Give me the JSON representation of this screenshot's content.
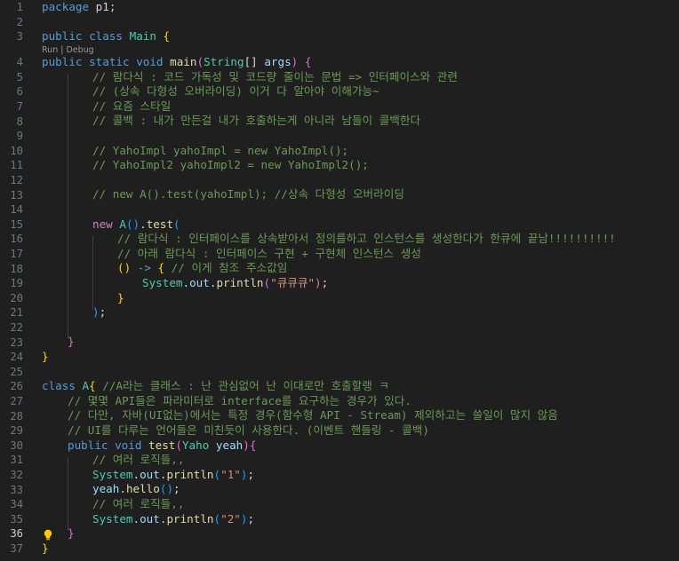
{
  "editor": {
    "line_numbers": [
      "1",
      "2",
      "3",
      "4",
      "5",
      "6",
      "7",
      "8",
      "9",
      "10",
      "11",
      "12",
      "13",
      "14",
      "15",
      "16",
      "17",
      "18",
      "19",
      "20",
      "21",
      "22",
      "23",
      "24",
      "25",
      "26",
      "27",
      "28",
      "29",
      "30",
      "31",
      "32",
      "33",
      "34",
      "35",
      "36",
      "37"
    ],
    "active_line": "36",
    "codelens": {
      "run": "Run",
      "separator": " | ",
      "debug": "Debug"
    },
    "code": {
      "l1_kw": "package",
      "l1_rest": " p1;",
      "l3_kw1": "public",
      "l3_kw2": "class",
      "l3_name": "Main",
      "l3_brace": "{",
      "l4_kw1": "public",
      "l4_kw2": "static",
      "l4_kw3": "void",
      "l4_fn": "main",
      "l4_type": "String",
      "l4_arr": "[]",
      "l4_arg": "args",
      "l5": "// 람다식 : 코드 가독성 및 코드량 줄이는 문법 => 인터페이스와 관련",
      "l6": "// (상속 다형성 오버라이딩) 이거 다 알아야 이해가능~",
      "l7": "// 요즘 스타일",
      "l8": "// 콜백 : 내가 만든걸 내가 호출하는게 아니라 남들이 콜백한다",
      "l10": "// YahoImpl yahoImpl = new YahoImpl();",
      "l11": "// YahoImpl2 yahoImpl2 = new YahoImpl2();",
      "l13": "// new A().test(yahoImpl); //상속 다형성 오버라이딩",
      "l15_new": "new",
      "l15_class": "A",
      "l15_fn": "test",
      "l16": "// 람다식 : 인터페이스를 상속받아서 정의를하고 인스턴스를 생성한다가 한큐에 끝남!!!!!!!!!!",
      "l17": "// 아래 람다식 : 인터페이스 구현 + 구현체 인스턴스 생성",
      "l18_arrow": "->",
      "l18_cm": "// 이게 참조 주소값임",
      "l19_sys": "System",
      "l19_out": "out",
      "l19_fn": "println",
      "l19_str": "\"큐큐큐\"",
      "l26_kw": "class",
      "l26_name": "A",
      "l26_cm": "//A라는 클래스 : 난 관심없어 난 이대로만 호출할랭 ㅋ",
      "l27": "// 몇몇 API들은 파라미터로 interface를 요구하는 경우가 있다.",
      "l28": "// 다만, 자바(UI없는)에서는 특정 경우(함수형 API - Stream) 제외하고는 쓸일이 많지 않음",
      "l29": "// UI를 다루는 언어들은 미친듯이 사용한다. (이벤트 핸들링 - 콜백)",
      "l30_kw1": "public",
      "l30_kw2": "void",
      "l30_fn": "test",
      "l30_type": "Yaho",
      "l30_var": "yeah",
      "l31": "// 여러 로직들,,",
      "l32_sys": "System",
      "l32_out": "out",
      "l32_fn": "println",
      "l32_str": "\"1\"",
      "l33_var": "yeah",
      "l33_fn": "hello",
      "l34": "// 여러 로직들,,",
      "l35_sys": "System",
      "l35_out": "out",
      "l35_fn": "println",
      "l35_str": "\"2\""
    },
    "icons": {
      "lightbulb": "lightbulb-icon"
    },
    "colors": {
      "background": "#1f1f1f",
      "keyword": "#569cd6",
      "type": "#4ec9b0",
      "function": "#dcdcaa",
      "variable": "#9cdcfe",
      "string": "#ce9178",
      "comment": "#6a9955",
      "bracket_1": "#ffd700",
      "bracket_2": "#da70d6",
      "bracket_3": "#179fff"
    }
  }
}
